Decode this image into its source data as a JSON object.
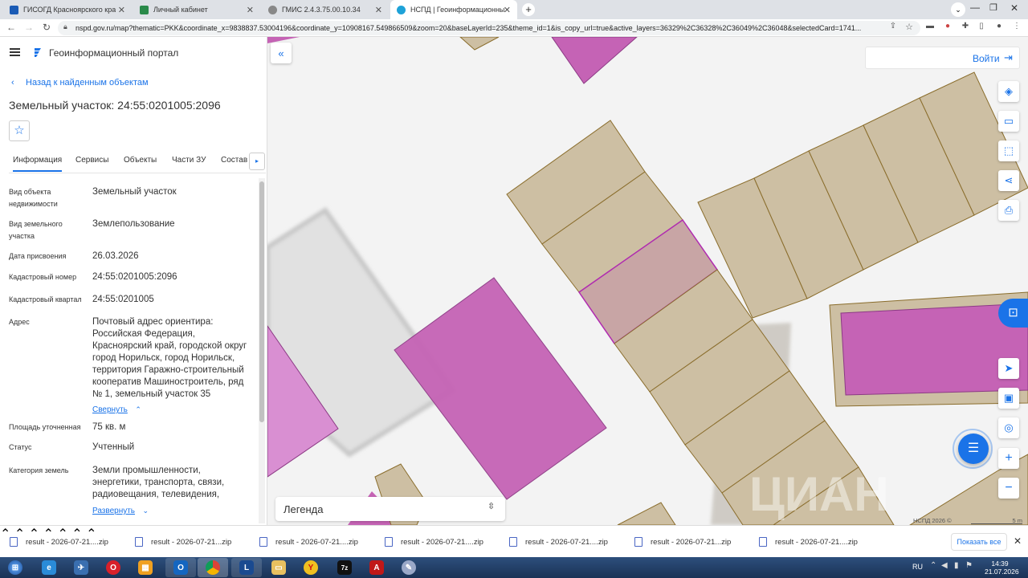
{
  "browser": {
    "tabs": [
      {
        "label": "ГИСОГД Красноярского края",
        "color": "#1a5bb5"
      },
      {
        "label": "Личный кабинет",
        "color": "#2a8a4a"
      },
      {
        "label": "ГМИС 2.4.3.75.00.10.34",
        "color": "#888888"
      },
      {
        "label": "НСПД | Геоинформационный п",
        "color": "#1ea2d8"
      }
    ],
    "new_tab": "+",
    "url": "nspd.gov.ru/map?thematic=PKK&coordinate_x=9838837.53004196&coordinate_y=10908167.549866509&zoom=20&baseLayerId=235&theme_id=1&is_copy_url=true&active_layers=36329%2C36328%2C36049%2C36048&selectedCard=1741..."
  },
  "portal": {
    "title": "Геоинформационный портал",
    "back_link": "Назад к найденным объектам",
    "object_title": "Земельный участок: 24:55:0201005:2096",
    "tabs": [
      "Информация",
      "Сервисы",
      "Объекты",
      "Части ЗУ",
      "Состав"
    ],
    "fields": [
      {
        "k": "Вид объекта недвижимости",
        "v": "Земельный участок"
      },
      {
        "k": "Вид земельного участка",
        "v": "Землепользование"
      },
      {
        "k": "Дата присвоения",
        "v": "26.03.2026"
      },
      {
        "k": "Кадастровый номер",
        "v": "24:55:0201005:2096"
      },
      {
        "k": "Кадастровый квартал",
        "v": "24:55:0201005"
      },
      {
        "k": "Адрес",
        "v": "Почтовый адрес ориентира: Российская Федерация, Красноярский край, городской округ город Норильск, город Норильск, территория Гаражно-строительный кооператив Машиностроитель, ряд № 1, земельный участок 35"
      },
      {
        "k": "Площадь уточненная",
        "v": "75 кв. м"
      },
      {
        "k": "Статус",
        "v": "Учтенный"
      },
      {
        "k": "Категория земель",
        "v": "Земли промышленности, энергетики, транспорта, связи, радиовещания, телевидения,"
      }
    ],
    "collapse_link": "Свернуть",
    "expand_link": "Развернуть"
  },
  "map": {
    "login": "Войти",
    "legend": "Легенда",
    "copyright": "НСПД 2026 ©",
    "scale": "5 m",
    "plus": "+",
    "minus": "−"
  },
  "downloads": {
    "items": [
      "result - 2026-07-21....zip",
      "result - 2026-07-21...zip",
      "result - 2026-07-21....zip",
      "result - 2026-07-21....zip",
      "result - 2026-07-21....zip",
      "result - 2026-07-21...zip",
      "result - 2026-07-21....zip"
    ],
    "show_all": "Показать все"
  },
  "taskbar": {
    "lang": "RU",
    "time": "14:39",
    "date": "21.07.2026"
  },
  "colors": {
    "parcel_fill": "#cdbfa3",
    "parcel_stroke": "#8a6d2c",
    "selected_fill": "#c8a5a5",
    "purple_fill": "#c563b5",
    "accent": "#1a73e8"
  }
}
